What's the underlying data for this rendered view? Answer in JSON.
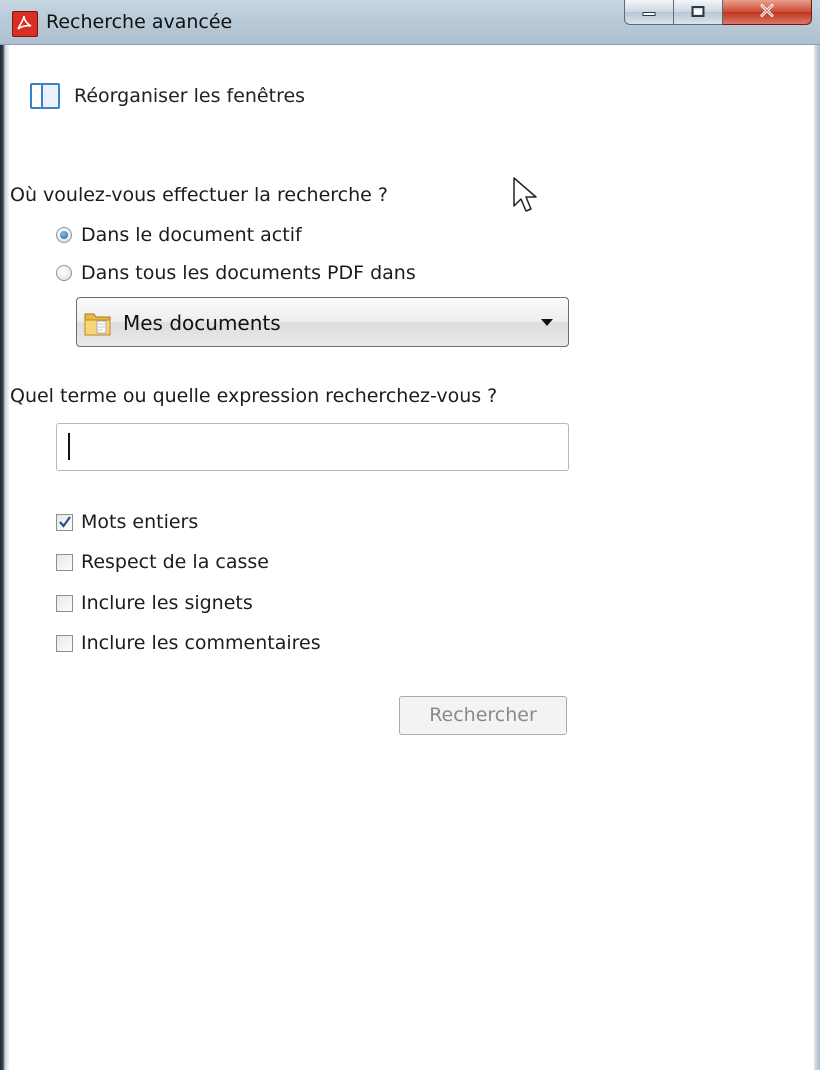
{
  "window": {
    "title": "Recherche avancée",
    "buttons": {
      "minimize": "minimize-icon",
      "maximize": "maximize-icon",
      "close": "close-icon"
    }
  },
  "toolbar": {
    "tile_label": "Réorganiser les fenêtres"
  },
  "location": {
    "question": "Où voulez-vous effectuer la recherche ?",
    "options": [
      {
        "label": "Dans le document actif",
        "selected": true
      },
      {
        "label": "Dans tous les documents PDF dans",
        "selected": false
      }
    ],
    "folder": "Mes documents"
  },
  "term": {
    "question": "Quel terme ou quelle expression recherchez-vous ?",
    "value": ""
  },
  "options": [
    {
      "label": "Mots entiers",
      "checked": true
    },
    {
      "label": "Respect de la casse",
      "checked": false
    },
    {
      "label": "Inclure les signets",
      "checked": false
    },
    {
      "label": "Inclure les commentaires",
      "checked": false
    }
  ],
  "actions": {
    "search": "Rechercher"
  },
  "colors": {
    "accent": "#3a82c4",
    "close": "#c7402b",
    "acrobat": "#d92e23"
  }
}
